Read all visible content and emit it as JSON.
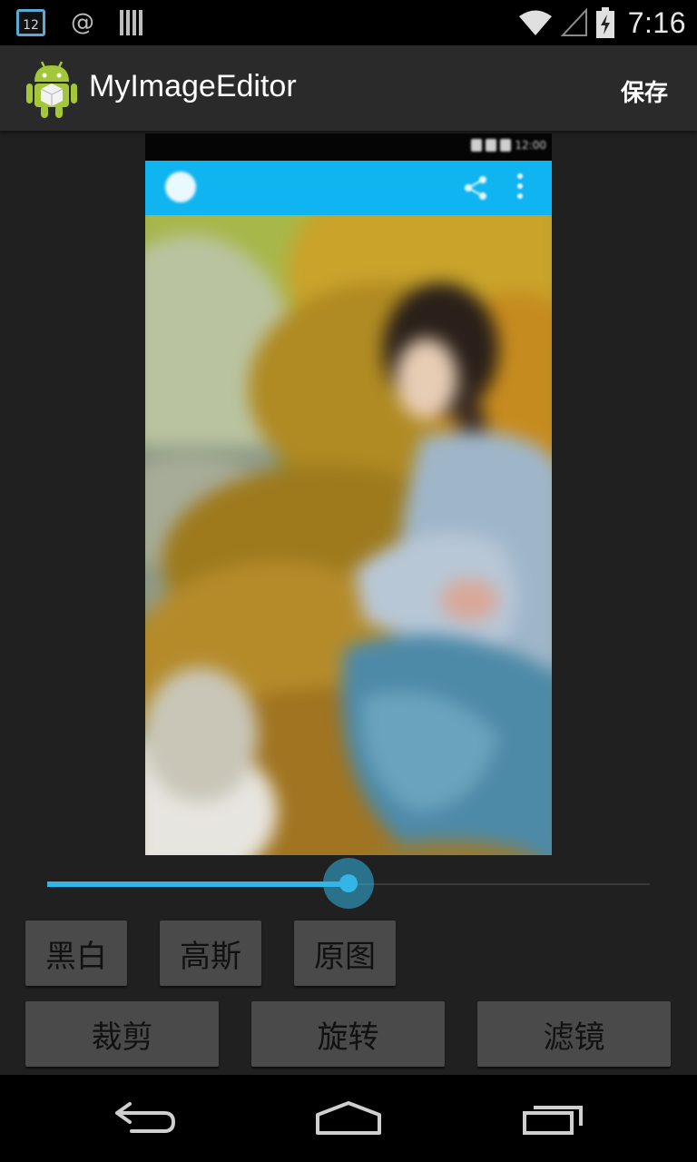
{
  "status_bar": {
    "time": "7:16",
    "calendar_day": "12",
    "at_symbol": "@",
    "icons": [
      "calendar-icon",
      "at-sign-icon",
      "sync-icon",
      "wifi-icon",
      "signal-icon",
      "battery-charging-icon"
    ]
  },
  "action_bar": {
    "title": "MyImageEditor",
    "app_icon": "android-app-icon",
    "save_label": "保存"
  },
  "preview": {
    "description_icons": [
      "app-logo-icon",
      "share-icon",
      "overflow-menu-icon"
    ],
    "status_time": "12:00",
    "accent": "#0fb4f0"
  },
  "seekbar": {
    "progress": 0.5,
    "color": "#33b5e5"
  },
  "buttons": {
    "row1": [
      "黑白",
      "高斯",
      "原图"
    ],
    "row2": [
      "裁剪",
      "旋转",
      "滤镜"
    ]
  },
  "nav_bar": {
    "icons": [
      "back-icon",
      "home-icon",
      "recent-apps-icon"
    ]
  }
}
